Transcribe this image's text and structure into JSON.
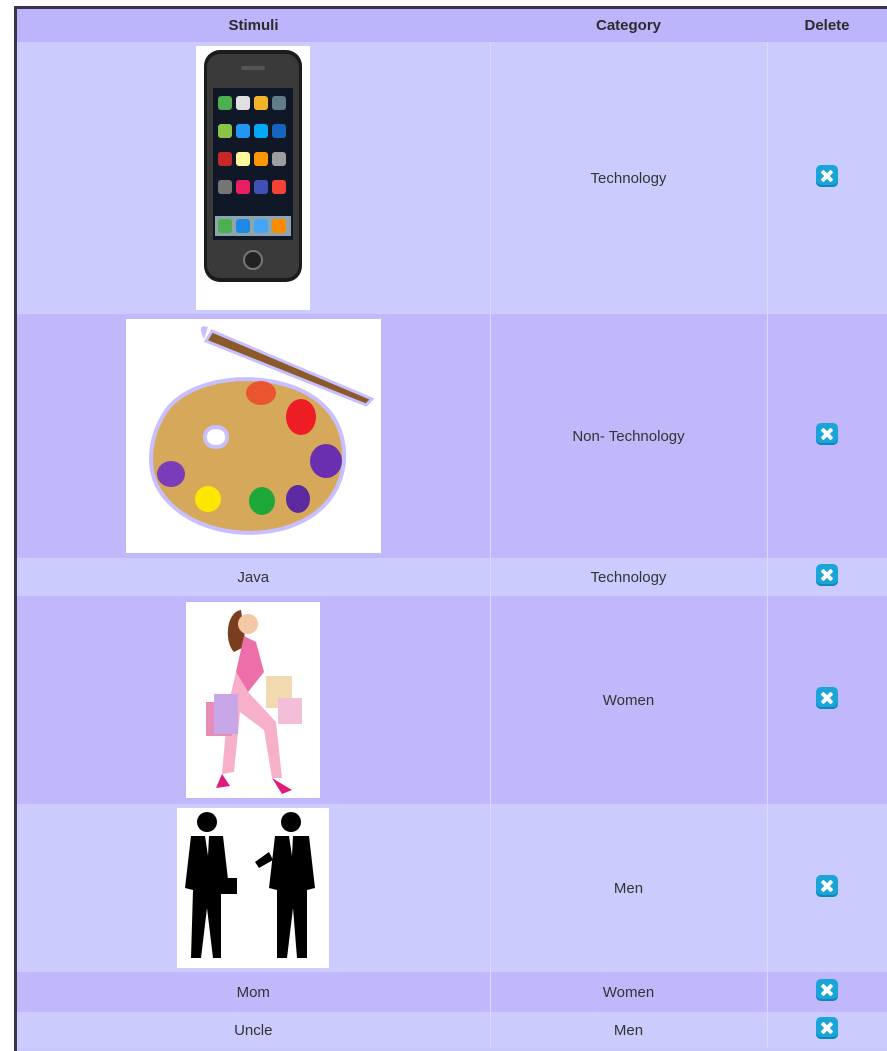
{
  "table": {
    "headers": {
      "stimuli": "Stimuli",
      "category": "Category",
      "delete": "Delete"
    },
    "rows": [
      {
        "stimulus_text": "",
        "stimulus_image": "smartphone-image",
        "category": "Technology"
      },
      {
        "stimulus_text": "",
        "stimulus_image": "paint-palette-image",
        "category": "Non- Technology"
      },
      {
        "stimulus_text": "Java",
        "stimulus_image": "",
        "category": "Technology"
      },
      {
        "stimulus_text": "",
        "stimulus_image": "woman-shopping-image",
        "category": "Women"
      },
      {
        "stimulus_text": "",
        "stimulus_image": "businessmen-silhouette-image",
        "category": "Men"
      },
      {
        "stimulus_text": "Mom",
        "stimulus_image": "",
        "category": "Women"
      },
      {
        "stimulus_text": "Uncle",
        "stimulus_image": "",
        "category": "Men"
      }
    ],
    "delete_icon": "delete-x-icon",
    "colors": {
      "header": "#bdb5fb",
      "row_light": "#cccbfd",
      "row_dark": "#c0b8fb",
      "delete_button": "#1aa4d8"
    }
  }
}
